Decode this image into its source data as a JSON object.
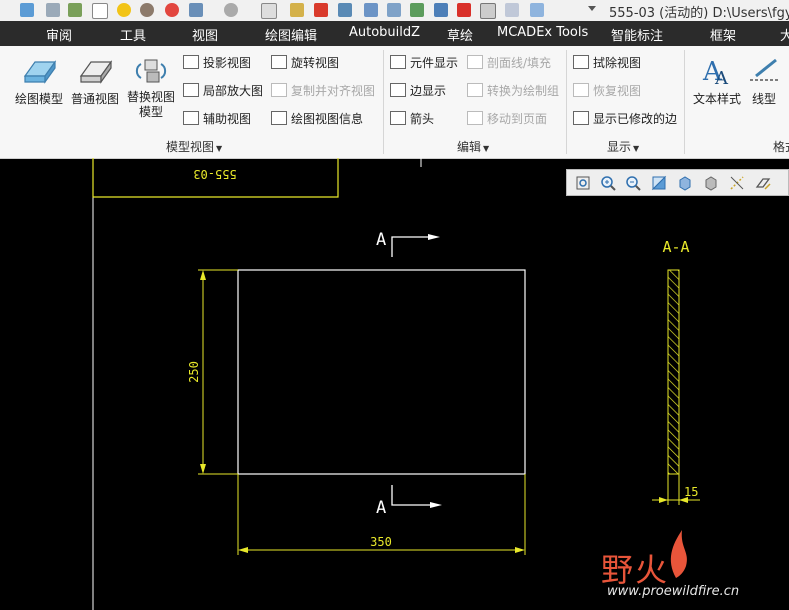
{
  "window": {
    "title": "555-03 (活动的) D:\\Users\\fgy"
  },
  "tabs": [
    "审阅",
    "工具",
    "视图",
    "绘图编辑",
    "AutobuildZ",
    "草绘",
    "MCADEx Tools",
    "智能标注",
    "框架",
    "大"
  ],
  "ribbon": {
    "model_views": {
      "big_buttons": [
        "绘图模型",
        "普通视图",
        "替换视图模型"
      ],
      "col1": [
        "投影视图",
        "局部放大图",
        "辅助视图"
      ],
      "col2": [
        "旋转视图",
        "复制并对齐视图",
        "绘图视图信息"
      ],
      "label": "模型视图"
    },
    "edit": {
      "col1": [
        "元件显示",
        "边显示",
        "箭头"
      ],
      "col2": [
        "剖面线/填充",
        "转换为绘制组",
        "移动到页面"
      ],
      "label": "编辑"
    },
    "display": {
      "items": [
        "拭除视图",
        "恢复视图",
        "显示已修改的边"
      ],
      "label": "显示"
    },
    "format": {
      "big_buttons": [
        "文本样式",
        "线型"
      ],
      "label": "格式"
    }
  },
  "drawing": {
    "view_label": "555-03",
    "section_letter_top": "A",
    "section_letter_bottom": "A",
    "section_title": "A-A",
    "dims": {
      "height": "250",
      "width": "350",
      "thickness": "15"
    }
  },
  "watermark": {
    "name": "野火",
    "url": "www.proewildfire.cn"
  },
  "colors": {
    "tab_bar": "#2b2b2b",
    "canvas": "#000000",
    "dimension": "#e8e82a",
    "geometry": "#ffffff",
    "watermark": "#e8553a"
  }
}
